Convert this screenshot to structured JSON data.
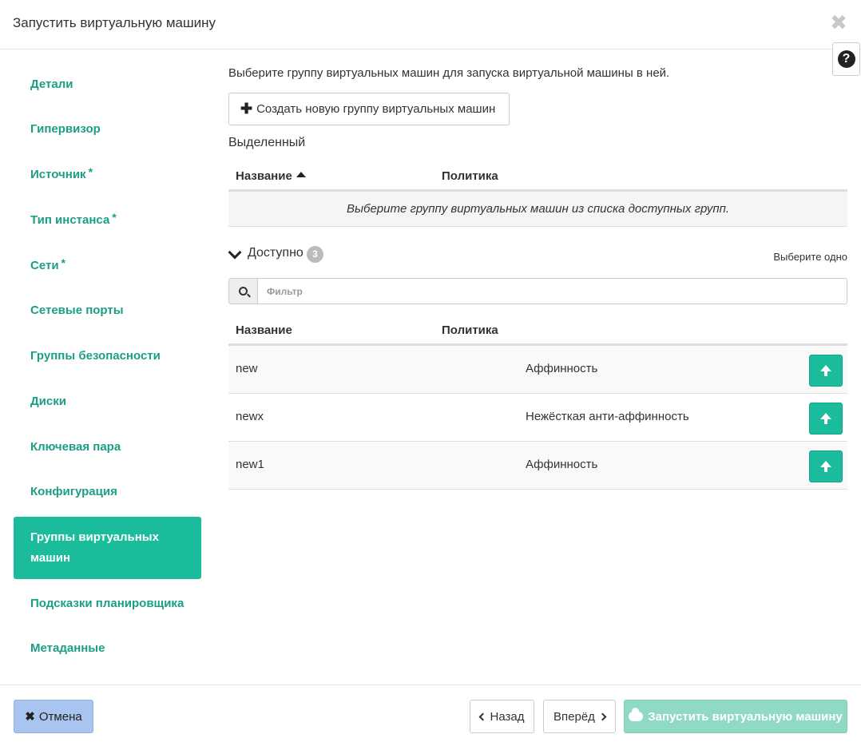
{
  "header": {
    "title": "Запустить виртуальную машину",
    "close_glyph": "✖",
    "help_glyph": "?"
  },
  "nav": {
    "items": [
      {
        "label": "Детали",
        "required": false
      },
      {
        "label": "Гипервизор",
        "required": false
      },
      {
        "label": "Источник",
        "required": true
      },
      {
        "label": "Тип инстанса",
        "required": true
      },
      {
        "label": "Сети",
        "required": true
      },
      {
        "label": "Сетевые порты",
        "required": false
      },
      {
        "label": "Группы безопасности",
        "required": false
      },
      {
        "label": "Диски",
        "required": false
      },
      {
        "label": "Ключевая пара",
        "required": false
      },
      {
        "label": "Конфигурация",
        "required": false
      },
      {
        "label": "Группы виртуальных машин",
        "required": false,
        "active": true
      },
      {
        "label": "Подсказки планировщика",
        "required": false
      },
      {
        "label": "Метаданные",
        "required": false
      }
    ],
    "required_mark": "*"
  },
  "main": {
    "intro": "Выберите группу виртуальных машин для запуска виртуальной машины в ней.",
    "create_button": "Создать новую группу виртуальных машин",
    "selected": {
      "label": "Выделенный",
      "col_name": "Название",
      "col_policy": "Политика",
      "empty_text": "Выберите группу виртуальных машин из списка доступных групп."
    },
    "available": {
      "label": "Доступно",
      "count": "3",
      "select_hint": "Выберите одно",
      "filter_placeholder": "Фильтр",
      "col_name": "Название",
      "col_policy": "Политика",
      "rows": [
        {
          "name": "new",
          "policy": "Аффинность"
        },
        {
          "name": "newx",
          "policy": "Нежёсткая анти-аффинность"
        },
        {
          "name": "new1",
          "policy": "Аффинность"
        }
      ]
    }
  },
  "footer": {
    "cancel": "Отмена",
    "back": "Назад",
    "next": "Вперёд",
    "launch": "Запустить виртуальную машину"
  },
  "colors": {
    "accent": "#1abc9c",
    "nav_text": "#1a9f85",
    "cancel_bg": "#a9c4ee",
    "launch_disabled": "#8fd9c5"
  }
}
